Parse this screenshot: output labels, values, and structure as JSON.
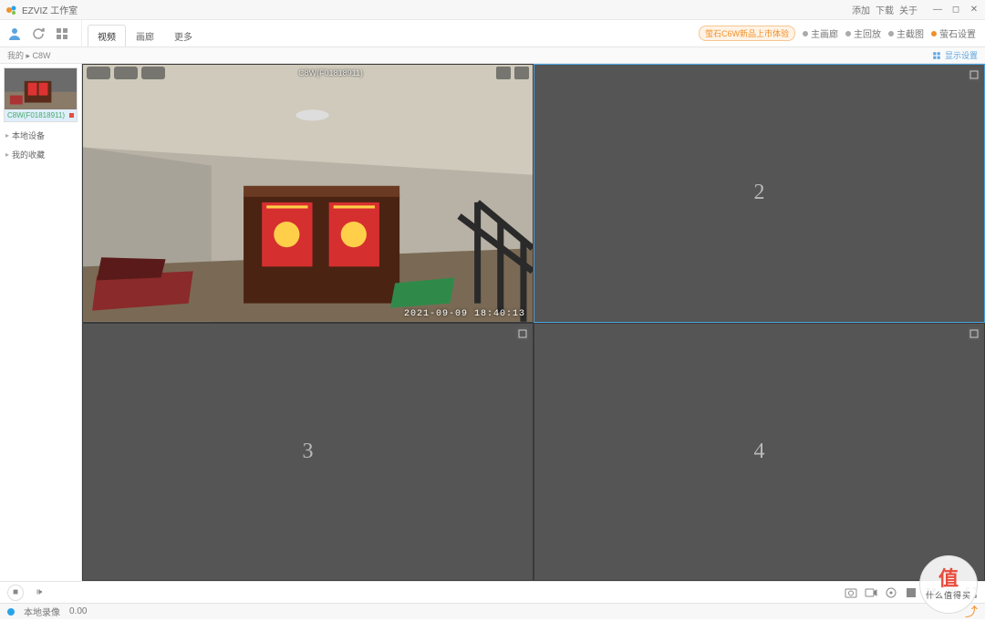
{
  "app": {
    "title": "EZVIZ 工作室"
  },
  "titlebar_right": {
    "item1": "添加",
    "item2": "下载",
    "item3": "关于"
  },
  "toolbar": {
    "tabs": [
      {
        "label": "视频"
      },
      {
        "label": "画廊"
      },
      {
        "label": "更多"
      }
    ],
    "right": {
      "ad": "萤石C6W新品上市体验",
      "link_gallery": "主画廊",
      "link_playback": "主回放",
      "link_snapshot": "主截图",
      "link_settings": "萤石设置"
    }
  },
  "crumb": {
    "left": "我的 ▸ C8W",
    "right": "显示设置"
  },
  "sidebar": {
    "thumb_caption": "C8W(F01818911)",
    "items": [
      {
        "label": "本地设备"
      },
      {
        "label": "我的收藏"
      }
    ]
  },
  "grid": {
    "cells": [
      {
        "num": "",
        "type": "live"
      },
      {
        "num": "2",
        "type": "empty",
        "selected": true
      },
      {
        "num": "3",
        "type": "empty"
      },
      {
        "num": "4",
        "type": "empty"
      }
    ],
    "live_osd": {
      "title": "C8W(F01818911)",
      "timestamp": "2021-09-09 18:40:13"
    }
  },
  "statusbar": {
    "left": "本地录像",
    "numbers": "0.00"
  },
  "watermark": {
    "glyph": "值",
    "txt": "什么值得买"
  }
}
